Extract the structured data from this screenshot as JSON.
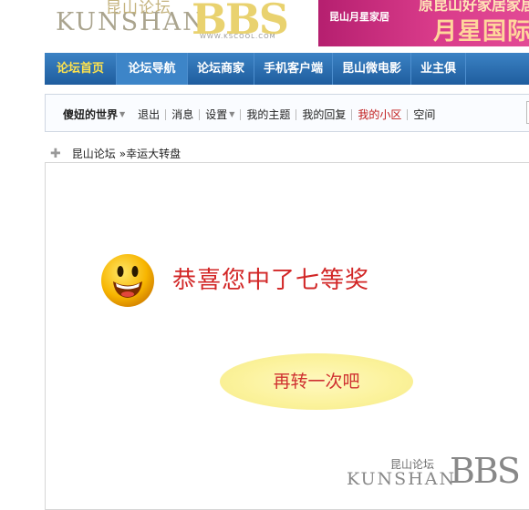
{
  "header": {
    "logo": {
      "cn": "昆山论坛",
      "en": "KUNSHAN",
      "bbs": "BBS",
      "url": "WWW.KSCOOL.COM"
    },
    "banner": {
      "top_text": "原昆山好家居家居",
      "brand": "昆山月星家居",
      "big_text": "月星国际"
    }
  },
  "main_nav": {
    "items": [
      {
        "label": "论坛首页"
      },
      {
        "label": "论坛导航"
      },
      {
        "label": "论坛商家"
      },
      {
        "label": "手机客户端"
      },
      {
        "label": "昆山微电影"
      },
      {
        "label": "业主俱"
      }
    ]
  },
  "toolbar": {
    "username": "傻妞的世界",
    "logout": "退出",
    "messages": "消息",
    "settings": "设置",
    "my_threads": "我的主题",
    "my_replies": "我的回复",
    "my_area": "我的小区",
    "space": "空间"
  },
  "breadcrumb": {
    "home": "昆山论坛",
    "separator": "»",
    "current": "幸运大转盘"
  },
  "result": {
    "message": "恭喜您中了七等奖",
    "again_button": "再转一次吧"
  },
  "watermark": {
    "cn": "昆山论坛",
    "en": "KUNSHAN",
    "bbs": "BBS"
  },
  "colors": {
    "nav_bg": "#2a6db0",
    "nav_home": "#ffe34d",
    "message_red": "#d22727",
    "button_yellow": "#fbf29a",
    "link_red": "#c01a1a"
  },
  "icons": [
    "plus-icon",
    "smiley-icon",
    "caret-down-icon"
  ]
}
